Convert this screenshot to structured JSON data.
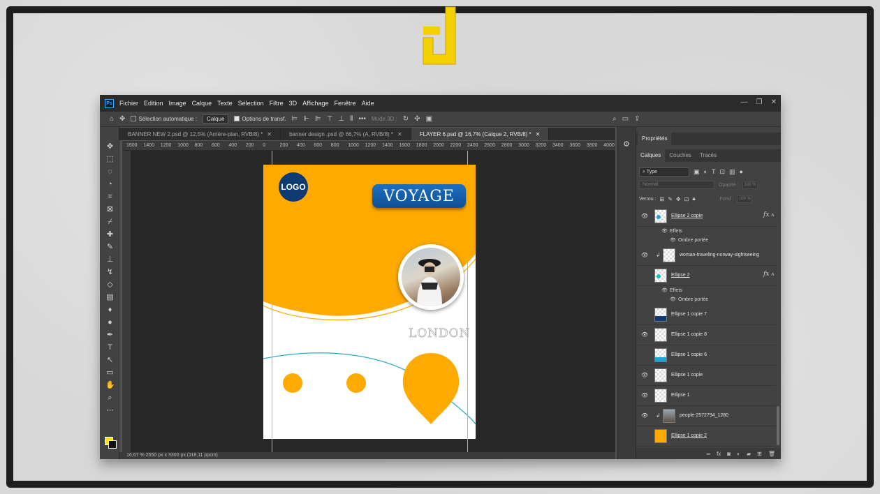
{
  "menubar": {
    "app_badge": "Ps",
    "items": [
      "Fichier",
      "Edition",
      "Image",
      "Calque",
      "Texte",
      "Sélection",
      "Filtre",
      "3D",
      "Affichage",
      "Fenêtre",
      "Aide"
    ]
  },
  "options_bar": {
    "auto_select_label": "Sélection automatique :",
    "auto_select_value": "Calque",
    "transform_label": "Options de transf.",
    "mode3d_label": "Mode 3D :"
  },
  "tabs": [
    {
      "label": "BANNER NEW 2.psd @ 12,5% (Arrière-plan, RVB/8) *"
    },
    {
      "label": "banner design .psd @ 66,7% (A, RVB/8) *"
    },
    {
      "label": "FLAYER 6.psd @ 16,7% (Calque 2, RVB/8) *"
    }
  ],
  "ruler": {
    "labels": [
      "1600",
      "1400",
      "1200",
      "1000",
      "800",
      "600",
      "400",
      "200",
      "0",
      "200",
      "400",
      "600",
      "800",
      "1000",
      "1200",
      "1400",
      "1600",
      "1800",
      "2000",
      "2200",
      "2400",
      "2600",
      "2800",
      "3000",
      "3200",
      "3400",
      "3600",
      "3800",
      "4000"
    ]
  },
  "status": {
    "text": "16,67 %      2550 px x 3300 px (118,11 ppcm)"
  },
  "flyer": {
    "logo_text": "LOGO",
    "title_text": "VOYAGE",
    "city_text": "LONDON",
    "accent_color": "#ffaa00",
    "blue_color": "#0f3b73"
  },
  "panels": {
    "properties_tab": "Propriétés",
    "tabs": [
      "Calques",
      "Couches",
      "Tracés"
    ],
    "filter_value": "Type",
    "blend_value": "Normal",
    "opacity_label": "Opacité :",
    "opacity_value": "100 %",
    "lock_label": "Verrou :",
    "fill_label": "Fond :",
    "fill_value": "100 %"
  },
  "layers": [
    {
      "name": "Ellipse 2 copie",
      "visible": true,
      "fx": true,
      "effects": [
        "Effets",
        "Ombre portée"
      ]
    },
    {
      "name": "woman-traveling-norway-sightseeing",
      "visible": true,
      "linked": true
    },
    {
      "name": "Ellipse 2",
      "visible": false,
      "fx": true,
      "effects": [
        "Effets",
        "Ombre portée"
      ]
    },
    {
      "name": "Ellipse 1 copie 7",
      "visible": false
    },
    {
      "name": "Ellipse 1 copie 8",
      "visible": true
    },
    {
      "name": "Ellipse 1 copie 6",
      "visible": false
    },
    {
      "name": "Ellipse 1 copie",
      "visible": true
    },
    {
      "name": "Ellipse 1",
      "visible": true
    },
    {
      "name": "people-2572794_1280",
      "visible": true,
      "linked": true
    },
    {
      "name": "Ellipse 1 copie 2",
      "visible": false
    }
  ]
}
